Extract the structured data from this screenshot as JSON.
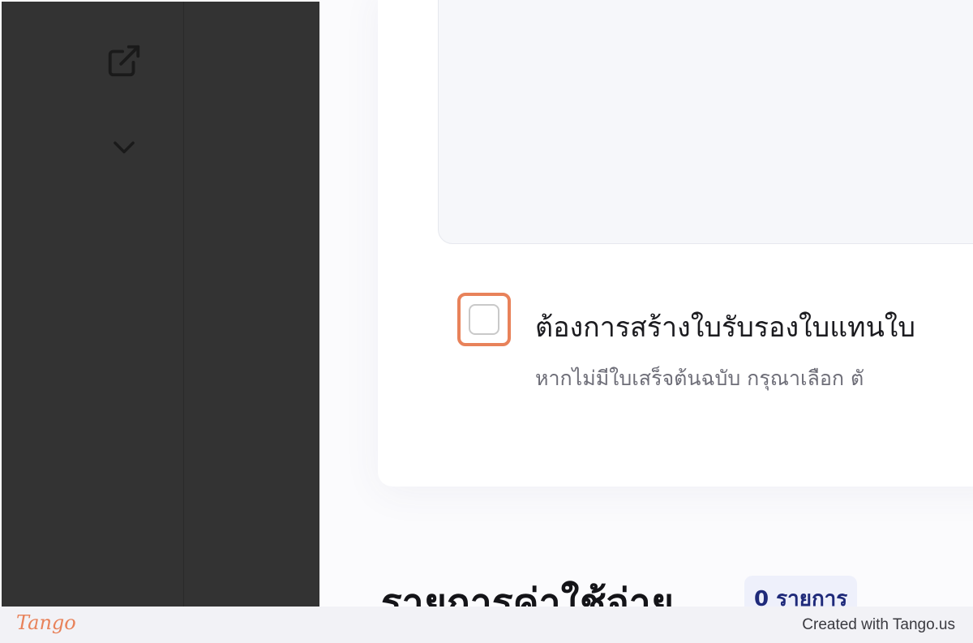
{
  "sidebar": {
    "icons": [
      "external-link-icon",
      "chevron-down-icon"
    ]
  },
  "form": {
    "checkbox_checked": false,
    "checkbox_label": "ต้องการสร้างใบรับรองใบแทนใบ",
    "checkbox_hint": "หากไม่มีใบเสร็จต้นฉบับ กรุณาเลือก ตั"
  },
  "expenses": {
    "title": "รายการค่าใช้จ่าย",
    "count_badge": "0 รายการ"
  },
  "footer": {
    "logo_text": "Tango",
    "credit": "Created with Tango.us"
  },
  "colors": {
    "highlight": "#e8825a",
    "sidebar_bg": "#333333",
    "badge_text": "#1f2a7a"
  }
}
